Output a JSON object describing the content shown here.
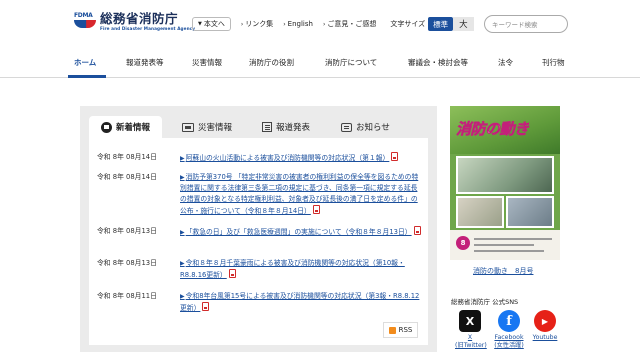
{
  "header": {
    "logo_mark": "FDMA",
    "logo_title": "総務省消防庁",
    "logo_sub": "Fire and Disaster Management Agency",
    "skip_label": "本文へ",
    "links": [
      {
        "label": "リンク集"
      },
      {
        "label": "English"
      },
      {
        "label": "ご意見・ご感想"
      }
    ],
    "font_size_label": "文字サイズ",
    "font_standard": "標準",
    "font_large": "大",
    "search_placeholder": "キーワード検索"
  },
  "nav": {
    "items": [
      {
        "label": "ホーム"
      },
      {
        "label": "報道発表等"
      },
      {
        "label": "災害情報"
      },
      {
        "label": "消防庁の役割"
      },
      {
        "label": "消防庁について"
      },
      {
        "label": "審議会・検討会等"
      },
      {
        "label": "法令"
      },
      {
        "label": "刊行物"
      }
    ],
    "active_index": 0
  },
  "news": {
    "tabs": [
      {
        "label": "新着情報",
        "icon": "news-icon"
      },
      {
        "label": "災害情報",
        "icon": "disaster-icon"
      },
      {
        "label": "報道発表",
        "icon": "report-icon"
      },
      {
        "label": "お知らせ",
        "icon": "notice-icon"
      }
    ],
    "items": [
      {
        "date": "令和 8年 08月14日",
        "title": "阿蘇山の火山活動による被害及び消防機関等の対応状況（第１報）",
        "pdf": true
      },
      {
        "date": "令和 8年 08月14日",
        "title": "消防予第370号 「特定非常災害の被害者の権利利益の保全等を図るための特別措置に関する法律第三条第二項の規定に基づき、同条第一項に規定する延長の措置の対象となる特定権利利益、対象者及び延長後の満了日を定める件」の公布・施行について（令和８年８月14日）",
        "pdf": true
      },
      {
        "date": "令和 8年 08月13日",
        "title": "「救急の日」及び「救急医療週間」の実施について（令和８年８月13日）",
        "pdf": true
      },
      {
        "date": "令和 8年 08月13日",
        "title": "令和８年８月千葉豪雨による被害及び消防機関等の対応状況（第10報・R8.8.16更新）",
        "pdf": true
      },
      {
        "date": "令和 8年 08月11日",
        "title": "令和8年台風第15号による被害及び消防機関等の対応状況（第3報・R8.8.12更新）",
        "pdf": true
      }
    ],
    "rss_label": "RSS"
  },
  "sidebar": {
    "magazine_title": "消防の動き",
    "magazine_number": "8",
    "magazine_caption": "消防の動き　8月号",
    "sns_label": "総務省消防庁 公式SNS",
    "sns": [
      {
        "name": "X",
        "caption_1": "X",
        "caption_2": "(旧Twitter)",
        "glyph": "X"
      },
      {
        "name": "Facebook",
        "caption_1": "Facebook",
        "caption_2": "(女性活躍)",
        "glyph": "f"
      },
      {
        "name": "Youtube",
        "caption_1": "Youtube",
        "caption_2": "",
        "glyph": "▶"
      }
    ]
  },
  "colors": {
    "brand_blue": "#1b4f9c",
    "pdf_red": "#d12c2c",
    "panel_gray": "#ebebeb"
  }
}
